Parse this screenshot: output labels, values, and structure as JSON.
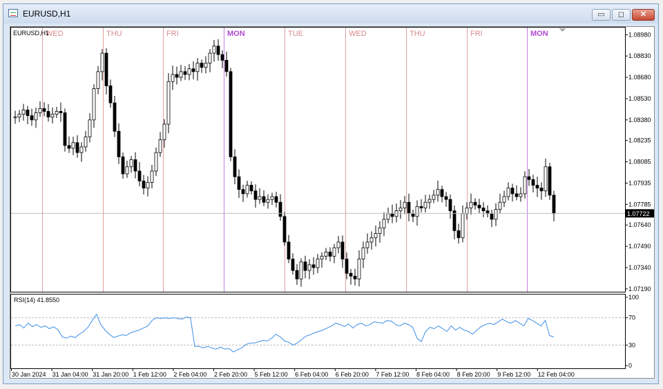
{
  "window": {
    "title": "EURUSD,H1",
    "buttons": {
      "minimize": "▭",
      "maximize": "◻",
      "close": "✕"
    }
  },
  "chart": {
    "symbol_label": "EURUSD,H1",
    "current_price_label": "1.07722",
    "rsi_label": "RSI(14) 41.8550"
  },
  "colors": {
    "day_separator": "#e0a0a0",
    "week_separator": "#c080e0",
    "day_text": "#d98a8a",
    "week_text": "#b04ad0",
    "rsi_line": "#3c8ee6",
    "candle": "#000000"
  },
  "chart_data": [
    {
      "type": "candlestick",
      "title": "EURUSD,H1",
      "day_labels": [
        "WED",
        "THU",
        "FRI",
        "MON",
        "TUE",
        "WED",
        "THU",
        "FRI",
        "MON"
      ],
      "day_label_style": [
        "day",
        "day",
        "day",
        "week",
        "day",
        "day",
        "day",
        "day",
        "week"
      ],
      "y_ticks": [
        "1.08980",
        "1.08830",
        "1.08680",
        "1.08530",
        "1.08380",
        "1.08235",
        "1.08085",
        "1.07935",
        "1.07785",
        "1.07640",
        "1.07490",
        "1.07340",
        "1.07190"
      ],
      "ylim": [
        1.0717,
        1.0903
      ],
      "x_ticks": [
        "30 Jan 2024",
        "31 Jan 04:00",
        "31 Jan 20:00",
        "1 Feb 12:00",
        "2 Feb 04:00",
        "2 Feb 20:00",
        "5 Feb 12:00",
        "6 Feb 04:00",
        "6 Feb 20:00",
        "7 Feb 12:00",
        "8 Feb 04:00",
        "8 Feb 20:00",
        "9 Feb 12:00",
        "12 Feb 04:00"
      ],
      "current_price": 1.07722,
      "close_series": [
        1.084,
        1.0842,
        1.0845,
        1.0841,
        1.0838,
        1.0843,
        1.0846,
        1.0844,
        1.084,
        1.0842,
        1.0844,
        1.0843,
        1.082,
        1.0818,
        1.0822,
        1.0815,
        1.0819,
        1.0826,
        1.0838,
        1.086,
        1.0872,
        1.0885,
        1.0862,
        1.085,
        1.083,
        1.0812,
        1.08,
        1.0805,
        1.081,
        1.0802,
        1.0795,
        1.079,
        1.0794,
        1.0802,
        1.0815,
        1.0824,
        1.0835,
        1.0865,
        1.087,
        1.0868,
        1.0872,
        1.087,
        1.0874,
        1.0872,
        1.0878,
        1.0875,
        1.0878,
        1.0885,
        1.089,
        1.0884,
        1.088,
        1.0872,
        1.0812,
        1.0798,
        1.0789,
        1.0786,
        1.0792,
        1.0788,
        1.0782,
        1.0784,
        1.078,
        1.0782,
        1.0784,
        1.078,
        1.077,
        1.0752,
        1.074,
        1.0732,
        1.0726,
        1.0738,
        1.0732,
        1.0736,
        1.0734,
        1.074,
        1.0742,
        1.0745,
        1.0742,
        1.0748,
        1.0752,
        1.074,
        1.073,
        1.0728,
        1.0726,
        1.074,
        1.0748,
        1.0752,
        1.0755,
        1.0758,
        1.0762,
        1.0768,
        1.0772,
        1.077,
        1.0774,
        1.0776,
        1.078,
        1.0772,
        1.077,
        1.0777,
        1.0776,
        1.078,
        1.0782,
        1.0785,
        1.0789,
        1.0784,
        1.0782,
        1.0774,
        1.076,
        1.0755,
        1.0772,
        1.0776,
        1.078,
        1.0778,
        1.0776,
        1.0774,
        1.0772,
        1.0768,
        1.0775,
        1.078,
        1.0784,
        1.079,
        1.0786,
        1.0784,
        1.0786,
        1.0798,
        1.0796,
        1.0792,
        1.079,
        1.0788,
        1.0805,
        1.0785,
        1.0772
      ],
      "rsi": {
        "label": "RSI(14) 41.8550",
        "ylim": [
          0,
          100
        ],
        "ticks": [
          "100",
          "70",
          "30",
          "0"
        ],
        "levels": [
          70,
          30
        ],
        "values": [
          58,
          60,
          55,
          62,
          57,
          60,
          56,
          58,
          54,
          57,
          52,
          42,
          40,
          43,
          41,
          46,
          50,
          56,
          66,
          75,
          60,
          52,
          46,
          41,
          43,
          45,
          44,
          48,
          50,
          52,
          55,
          58,
          66,
          70,
          69,
          70,
          69,
          70,
          69,
          68,
          71,
          70,
          28,
          28,
          26,
          28,
          26,
          24,
          27,
          24,
          25,
          20,
          23,
          26,
          31,
          33,
          33,
          35,
          37,
          36,
          40,
          46,
          42,
          36,
          34,
          30,
          33,
          38,
          43,
          45,
          48,
          50,
          52,
          55,
          58,
          62,
          60,
          57,
          61,
          55,
          60,
          62,
          58,
          60,
          64,
          63,
          62,
          66,
          65,
          60,
          58,
          62,
          60,
          56,
          40,
          35,
          50,
          56,
          54,
          58,
          54,
          50,
          58,
          52,
          56,
          52,
          50,
          46,
          52,
          57,
          60,
          62,
          60,
          64,
          68,
          64,
          62,
          66,
          62,
          58,
          69,
          66,
          62,
          58,
          66,
          44,
          41.855
        ]
      }
    }
  ]
}
